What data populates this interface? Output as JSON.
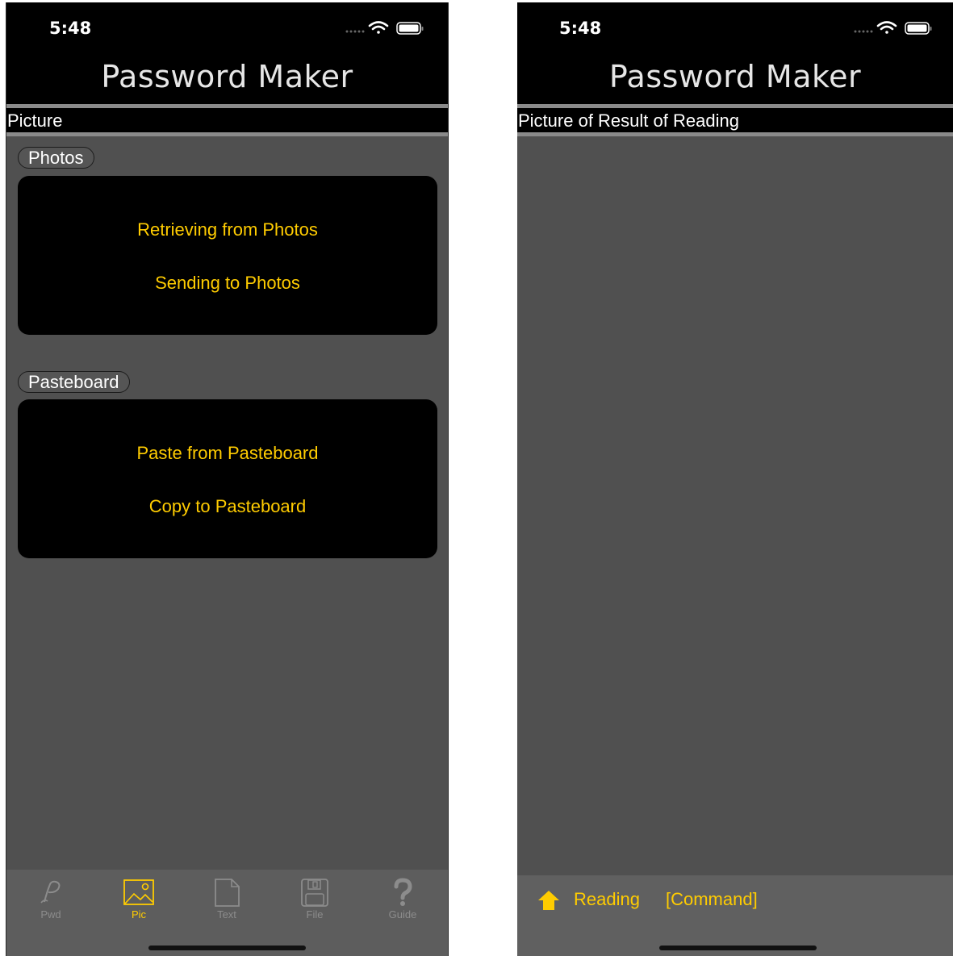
{
  "left_screen": {
    "status_time": "5:48",
    "nav_title": "Password Maker",
    "section_header": "Picture",
    "groups": [
      {
        "label": "Photos",
        "actions": [
          "Retrieving from Photos",
          "Sending to Photos"
        ]
      },
      {
        "label": "Pasteboard",
        "actions": [
          "Paste from Pasteboard",
          "Copy to Pasteboard"
        ]
      }
    ],
    "tabs": [
      {
        "label": "Pwd",
        "icon": "script-p-icon",
        "active": false
      },
      {
        "label": "Pic",
        "icon": "picture-icon",
        "active": true
      },
      {
        "label": "Text",
        "icon": "document-icon",
        "active": false
      },
      {
        "label": "File",
        "icon": "floppy-disk-icon",
        "active": false
      },
      {
        "label": "Guide",
        "icon": "question-mark-icon",
        "active": false
      }
    ]
  },
  "right_screen": {
    "status_time": "5:48",
    "nav_title": "Password Maker",
    "section_header": "Picture of Result of Reading",
    "toolbar": {
      "home_icon": "house-icon",
      "reading_label": "Reading",
      "command_label": "[Command]"
    }
  },
  "colors": {
    "accent": "#ffcc00",
    "background": "#505050",
    "bar": "#000000",
    "tab_inactive": "#8c8c8c"
  }
}
